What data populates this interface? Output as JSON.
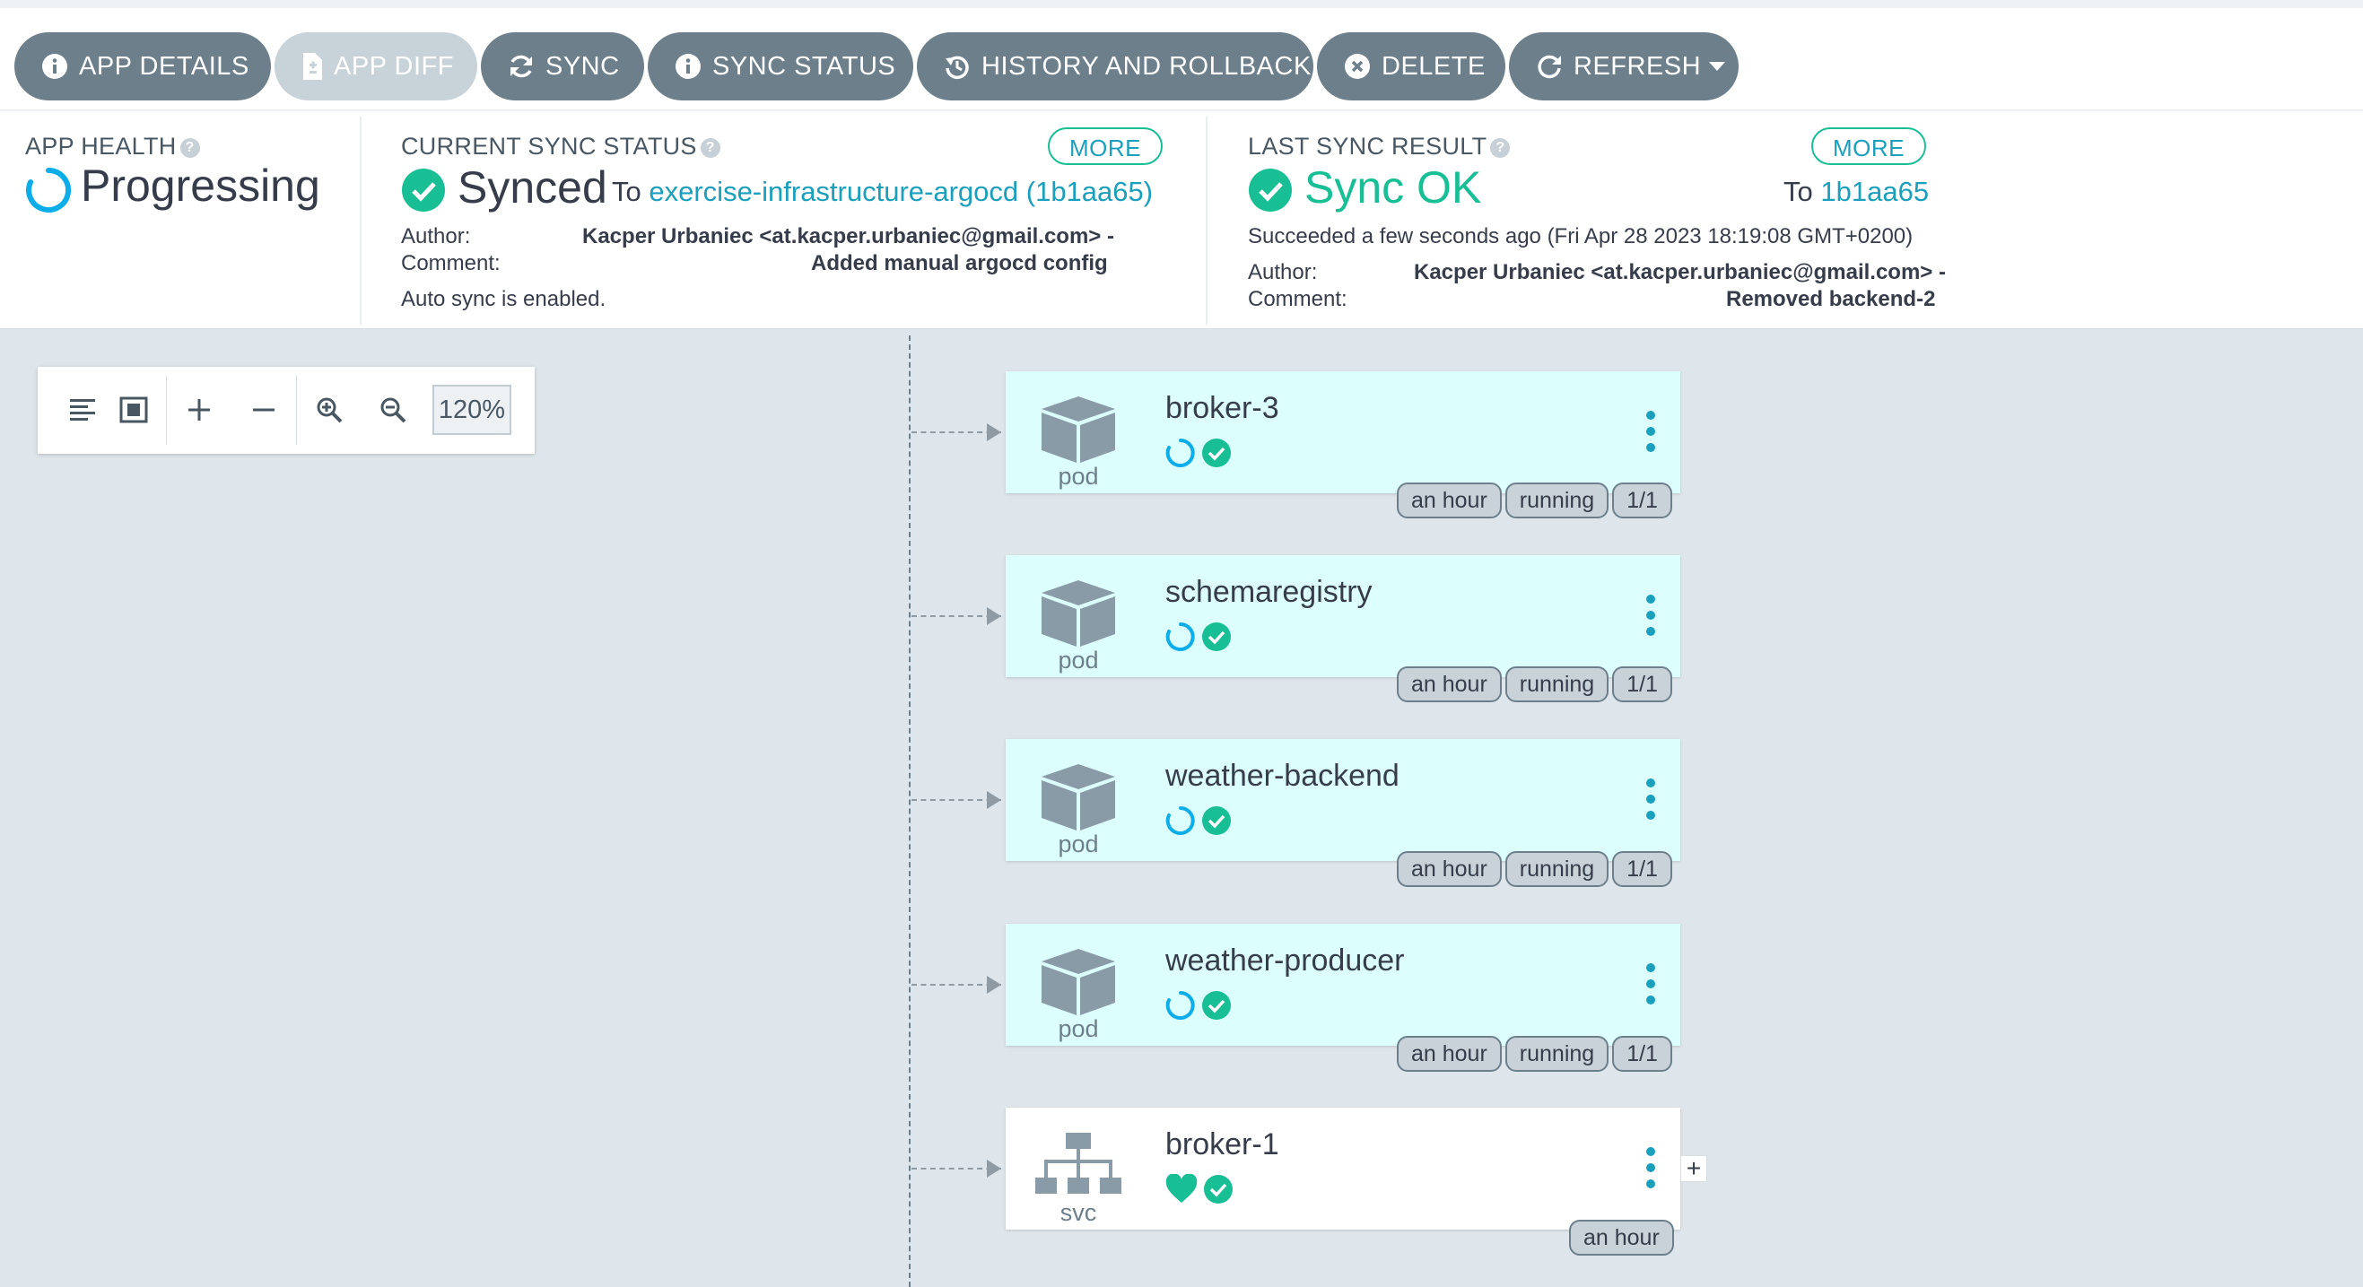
{
  "toolbar": {
    "app_details": "APP DETAILS",
    "app_diff": "APP DIFF",
    "sync": "SYNC",
    "sync_status": "SYNC STATUS",
    "history": "HISTORY AND ROLLBACK",
    "delete": "DELETE",
    "refresh": "REFRESH"
  },
  "health": {
    "label": "APP HEALTH",
    "value": "Progressing"
  },
  "current_sync": {
    "label": "CURRENT SYNC STATUS",
    "more": "MORE",
    "status": "Synced",
    "to": "To",
    "target": "exercise-infrastructure-argocd (1b1aa65)",
    "author_label": "Author:",
    "author": "Kacper Urbaniec <at.kacper.urbaniec@gmail.com> -",
    "comment_label": "Comment:",
    "comment": "Added manual argocd config",
    "auto_sync": "Auto sync is enabled."
  },
  "last_sync": {
    "label": "LAST SYNC RESULT",
    "more": "MORE",
    "status": "Sync OK",
    "to": "To",
    "revision": "1b1aa65",
    "succeeded": "Succeeded a few seconds ago (Fri Apr 28 2023 18:19:08 GMT+0200)",
    "author_label": "Author:",
    "author": "Kacper Urbaniec <at.kacper.urbaniec@gmail.com> -",
    "comment_label": "Comment:",
    "comment": "Removed backend-2"
  },
  "zoom": {
    "level": "120%"
  },
  "nodes": [
    {
      "name": "broker-3",
      "kind": "pod",
      "tags": [
        "an hour",
        "running",
        "1/1"
      ]
    },
    {
      "name": "schemaregistry",
      "kind": "pod",
      "tags": [
        "an hour",
        "running",
        "1/1"
      ]
    },
    {
      "name": "weather-backend",
      "kind": "pod",
      "tags": [
        "an hour",
        "running",
        "1/1"
      ]
    },
    {
      "name": "weather-producer",
      "kind": "pod",
      "tags": [
        "an hour",
        "running",
        "1/1"
      ]
    },
    {
      "name": "broker-1",
      "kind": "svc",
      "tags": [
        "an hour"
      ],
      "expand": "+"
    }
  ],
  "colors": {
    "accent": "#1a9fbd",
    "synced_green": "#18be94",
    "progressing_blue": "#0dadea",
    "button_grey": "#6d7f8b"
  }
}
